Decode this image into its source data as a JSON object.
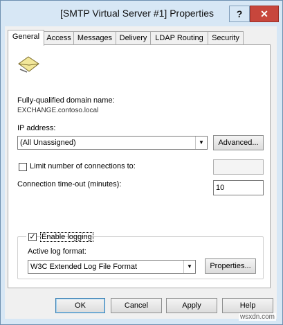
{
  "window": {
    "title": "[SMTP Virtual Server #1] Properties",
    "help_glyph": "?",
    "close_glyph": "✕"
  },
  "tabs": [
    {
      "label": "General"
    },
    {
      "label": "Access"
    },
    {
      "label": "Messages"
    },
    {
      "label": "Delivery"
    },
    {
      "label": "LDAP Routing"
    },
    {
      "label": "Security"
    }
  ],
  "general": {
    "icon": "envelope-icon",
    "fqdn_label": "Fully-qualified domain name:",
    "fqdn_value": "EXCHANGE.contoso.local",
    "ip_label": "IP address:",
    "ip_value": "(All Unassigned)",
    "advanced_button": "Advanced...",
    "limit_checkbox_label": "Limit number of connections to:",
    "limit_checked": false,
    "limit_value": "",
    "timeout_label": "Connection time-out (minutes):",
    "timeout_value": "10",
    "enable_logging_label": "Enable logging",
    "enable_logging_checked": true,
    "log_format_label": "Active log format:",
    "log_format_value": "W3C Extended Log File Format",
    "properties_button": "Properties..."
  },
  "footer": {
    "ok": "OK",
    "cancel": "Cancel",
    "apply": "Apply",
    "help": "Help"
  },
  "watermark": "wsxdn.com",
  "colors": {
    "frame": "#d7e7f5",
    "close": "#c7463c",
    "panel": "#ffffff"
  }
}
